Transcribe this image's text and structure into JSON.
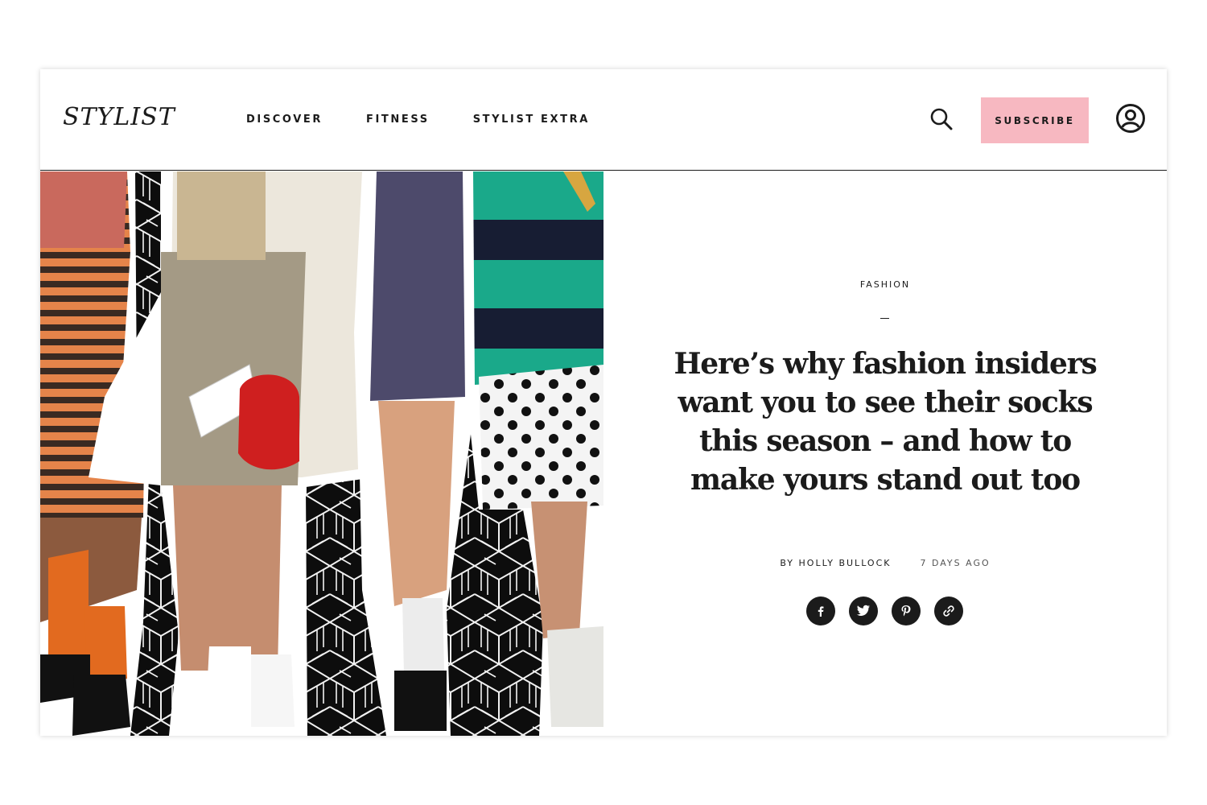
{
  "header": {
    "logo": "STYLIST",
    "nav": [
      {
        "label": "DISCOVER"
      },
      {
        "label": "FITNESS"
      },
      {
        "label": "STYLIST EXTRA"
      }
    ],
    "subscribe_label": "SUBSCRIBE",
    "icons": {
      "search": "search-icon",
      "account": "user-circle-icon"
    },
    "subscribe_color": "#f7b8c1"
  },
  "hero": {
    "image_semantic": "collage of street-style legs wearing socks and shoes on a black geometric background"
  },
  "article": {
    "category": "FASHION",
    "title": "Here’s why fashion insiders want you to see their socks this season – and how to make yours stand out too",
    "byline": "BY HOLLY BULLOCK",
    "date": "7 DAYS AGO",
    "share": [
      {
        "icon": "facebook-icon"
      },
      {
        "icon": "twitter-icon"
      },
      {
        "icon": "pinterest-icon"
      },
      {
        "icon": "link-icon"
      }
    ]
  }
}
